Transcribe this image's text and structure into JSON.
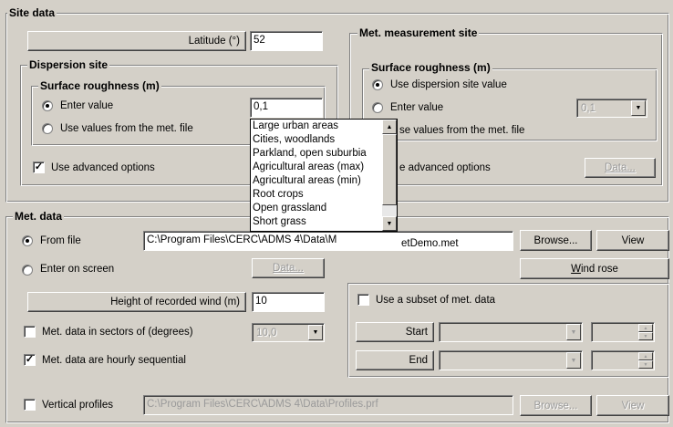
{
  "site_data": {
    "title": "Site data",
    "latitude_label": "Latitude (°)",
    "latitude_value": "52"
  },
  "dispersion_site": {
    "title": "Dispersion site",
    "surface_roughness_title": "Surface roughness (m)",
    "enter_value_label": "Enter value",
    "enter_value_selected": true,
    "roughness_value": "0,1",
    "use_met_file_label": "Use values from the met. file",
    "advanced_label": "Use advanced options",
    "advanced_checked": true
  },
  "dropdown": {
    "items": [
      "Large urban areas",
      "Cities, woodlands",
      "Parkland, open suburbia",
      "Agricultural areas (max)",
      "Agricultural areas (min)",
      "Root crops",
      "Open grassland",
      "Short grass"
    ]
  },
  "met_site": {
    "title": "Met. measurement site",
    "surface_roughness_title": "Surface roughness (m)",
    "use_dispersion_label": "Use dispersion site value",
    "enter_value_label": "Enter value",
    "roughness_value": "0,1",
    "use_met_file_label": "Use values from the met. file",
    "use_met_file_visible": "se values from the met. file",
    "advanced_label": "Use advanced options",
    "advanced_visible": "e advanced options",
    "data_button": "Data..."
  },
  "met_data": {
    "title": "Met. data",
    "from_file_label": "From file",
    "file_path": "C:\\Program Files\\CERC\\ADMS 4\\Data\\MetDemo.met",
    "file_path_visible": "C:\\Program Files\\CERC\\ADMS 4\\Data\\M",
    "file_path_tail": "etDemo.met",
    "browse_button": "Browse...",
    "view_button": "View",
    "enter_on_screen_label": "Enter on screen",
    "data_button": "Data...",
    "wind_rose_button_first": "W",
    "wind_rose_button_rest": "ind rose",
    "height_label": "Height of recorded wind (m)",
    "height_value": "10",
    "sectors_label": "Met. data in sectors of (degrees)",
    "sectors_value": "10,0",
    "hourly_label": "Met. data are hourly sequential",
    "hourly_checked": true,
    "subset_label": "Use a subset of met. data",
    "start_button": "Start",
    "end_button": "End",
    "vertical_label": "Vertical profiles",
    "vertical_path": "C:\\Program Files\\CERC\\ADMS 4\\Data\\Profiles.prf",
    "vertical_browse": "Browse...",
    "vertical_view": "View"
  }
}
